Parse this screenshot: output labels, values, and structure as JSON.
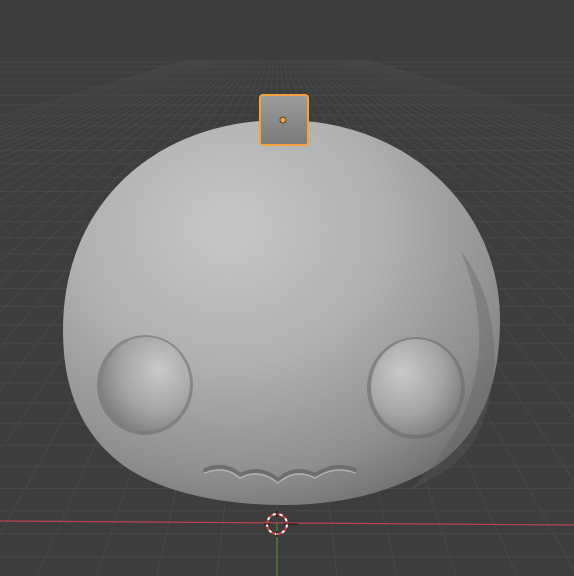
{
  "viewport": {
    "mode": "object",
    "shading": "solid"
  },
  "scene": {
    "objects": [
      {
        "name_icon": "sculpted-mesh",
        "selected": false
      },
      {
        "name_icon": "cube-mesh",
        "selected": true
      }
    ],
    "axes": {
      "x_color": "#b84350",
      "y_color": "#5c8a2e"
    },
    "colors": {
      "background": "#3d3d3d",
      "grid": "#4a4a4a",
      "selection_outline": "#f5a142",
      "origin_dot": "#f5a142",
      "mesh_light": "#c8c8c8",
      "mesh_dark": "#6b6b6b"
    }
  }
}
